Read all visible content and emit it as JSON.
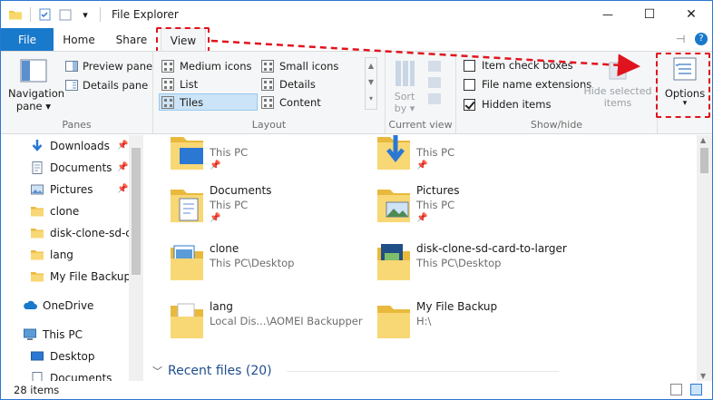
{
  "window": {
    "title": "File Explorer",
    "minimize_glyph": "—",
    "maximize_glyph": "☐",
    "close_glyph": "✕",
    "quick_access_chevron": "▾"
  },
  "tabs": [
    {
      "label": "File"
    },
    {
      "label": "Home"
    },
    {
      "label": "Share"
    },
    {
      "label": "View"
    }
  ],
  "ribbon": {
    "panes": {
      "navigation_pane": "Navigation pane ▾",
      "preview_pane": "Preview pane",
      "details_pane": "Details pane",
      "label": "Panes"
    },
    "layout": {
      "items": [
        "Medium icons",
        "Small icons",
        "List",
        "Details",
        "Tiles",
        "Content"
      ],
      "selected": "Tiles",
      "label": "Layout"
    },
    "current_view": {
      "sort_by": "Sort by ▾",
      "label": "Current view"
    },
    "show_hide": {
      "item_check_boxes": "Item check boxes",
      "file_name_extensions": "File name extensions",
      "hidden_items": "Hidden items",
      "hide_selected_items": "Hide selected items",
      "label": "Show/hide"
    },
    "options": {
      "label": "Options",
      "chevron": "▾"
    }
  },
  "nav_pane": {
    "items": [
      {
        "label": "Downloads",
        "icon": "download-icon",
        "pinned": true
      },
      {
        "label": "Documents",
        "icon": "documents-icon",
        "pinned": true
      },
      {
        "label": "Pictures",
        "icon": "pictures-icon",
        "pinned": true
      },
      {
        "label": "clone",
        "icon": "folder-icon",
        "pinned": false
      },
      {
        "label": "disk-clone-sd-ca",
        "icon": "folder-icon",
        "pinned": false
      },
      {
        "label": "lang",
        "icon": "folder-icon",
        "pinned": false
      },
      {
        "label": "My File Backup",
        "icon": "folder-icon",
        "pinned": false
      },
      {
        "label": "OneDrive",
        "icon": "cloud-icon",
        "pinned": false
      },
      {
        "label": "This PC",
        "icon": "computer-icon",
        "pinned": false
      },
      {
        "label": "Desktop",
        "icon": "desktop-icon",
        "pinned": false
      },
      {
        "label": "Documents",
        "icon": "documents-icon",
        "pinned": false
      }
    ]
  },
  "content": {
    "tiles": [
      {
        "name": "",
        "sub": "This PC",
        "pinned": true,
        "icon": "desktop-folder-icon"
      },
      {
        "name": "",
        "sub": "This PC",
        "pinned": true,
        "icon": "downloads-folder-icon"
      },
      {
        "name": "Documents",
        "sub": "This PC",
        "pinned": true,
        "icon": "documents-folder-icon"
      },
      {
        "name": "Pictures",
        "sub": "This PC",
        "pinned": true,
        "icon": "pictures-folder-icon"
      },
      {
        "name": "clone",
        "sub": "This PC\\Desktop",
        "pinned": false,
        "icon": "clone-folder-icon"
      },
      {
        "name": "disk-clone-sd-card-to-larger",
        "sub": "This PC\\Desktop",
        "pinned": false,
        "icon": "disk-clone-folder-icon"
      },
      {
        "name": "lang",
        "sub": "Local Dis...\\AOMEI Backupper",
        "pinned": false,
        "icon": "lang-folder-icon"
      },
      {
        "name": "My File Backup",
        "sub": "H:\\",
        "pinned": false,
        "icon": "backup-folder-icon"
      }
    ],
    "recent_files": "Recent files (20)",
    "pin_glyph": "📌"
  },
  "status": {
    "item_count": "28 items"
  },
  "colors": {
    "accent": "#1979ca",
    "highlight": "#e0141e",
    "folder": "#f3d371"
  }
}
